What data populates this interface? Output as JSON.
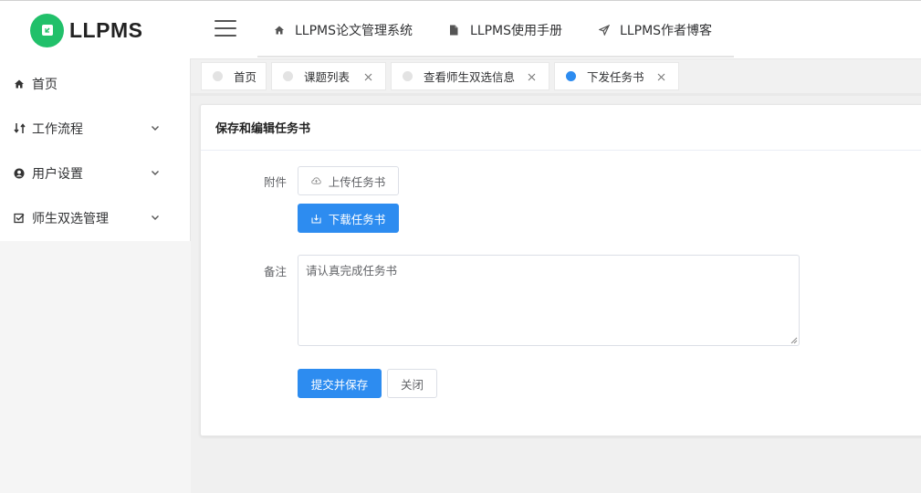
{
  "app": {
    "logo_text": "LLPMS",
    "accent_color": "#2d8cf0",
    "logo_color": "#21c06a"
  },
  "sidebar": {
    "items": [
      {
        "label": "首页",
        "icon": "home-icon",
        "expandable": false
      },
      {
        "label": "工作流程",
        "icon": "workflow-icon",
        "expandable": true
      },
      {
        "label": "用户设置",
        "icon": "user-circle-icon",
        "expandable": true
      },
      {
        "label": "师生双选管理",
        "icon": "checkbox-icon",
        "expandable": true
      }
    ]
  },
  "header": {
    "nav": [
      {
        "label": "LLPMS论文管理系统",
        "icon": "home-icon"
      },
      {
        "label": "LLPMS使用手册",
        "icon": "document-icon"
      },
      {
        "label": "LLPMS作者博客",
        "icon": "send-icon"
      }
    ]
  },
  "tabs": [
    {
      "label": "首页",
      "closable": false,
      "active": false
    },
    {
      "label": "课题列表",
      "closable": true,
      "active": false
    },
    {
      "label": "查看师生双选信息",
      "closable": true,
      "active": false
    },
    {
      "label": "下发任务书",
      "closable": true,
      "active": true
    }
  ],
  "card": {
    "title": "保存和编辑任务书",
    "attachment_label": "附件",
    "upload_button": "上传任务书",
    "download_button": "下载任务书",
    "remarks_label": "备注",
    "remarks_value": "请认真完成任务书",
    "submit_button": "提交并保存",
    "close_button": "关闭"
  }
}
